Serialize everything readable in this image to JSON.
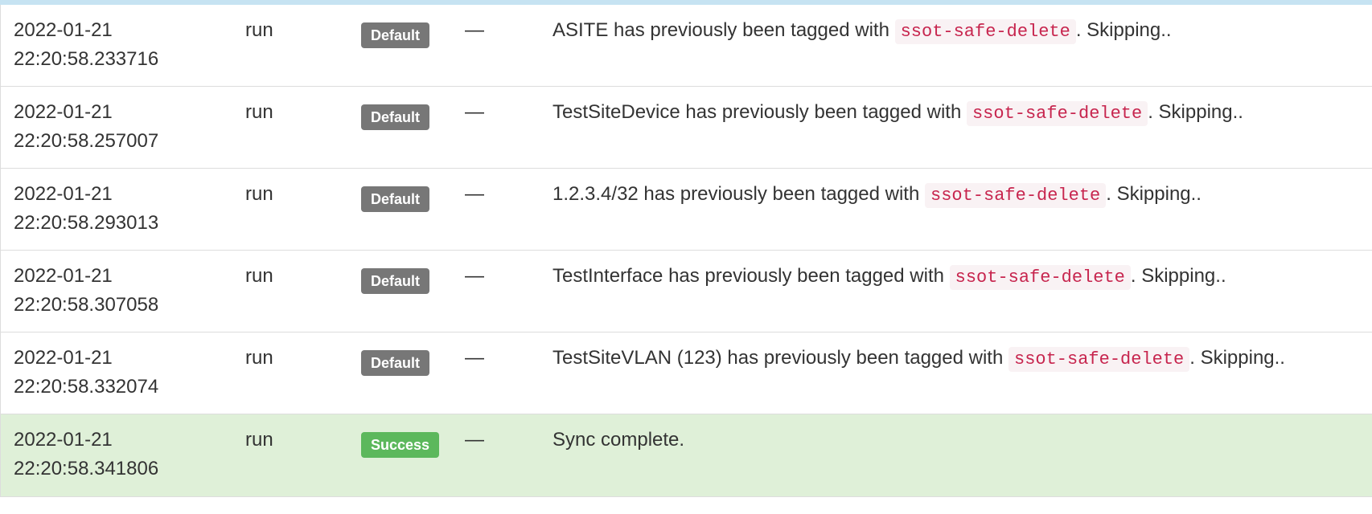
{
  "rows": [
    {
      "date": "2022-01-21",
      "time": "22:20:58.233716",
      "grouping": "run",
      "level": "Default",
      "object": "—",
      "message_pre": "ASITE has previously been tagged with",
      "message_code": "ssot-safe-delete",
      "message_post": ". Skipping.."
    },
    {
      "date": "2022-01-21",
      "time": "22:20:58.257007",
      "grouping": "run",
      "level": "Default",
      "object": "—",
      "message_pre": "TestSiteDevice has previously been tagged with",
      "message_code": "ssot-safe-delete",
      "message_post": ". Skipping.."
    },
    {
      "date": "2022-01-21",
      "time": "22:20:58.293013",
      "grouping": "run",
      "level": "Default",
      "object": "—",
      "message_pre": "1.2.3.4/32 has previously been tagged with",
      "message_code": "ssot-safe-delete",
      "message_post": ". Skipping.."
    },
    {
      "date": "2022-01-21",
      "time": "22:20:58.307058",
      "grouping": "run",
      "level": "Default",
      "object": "—",
      "message_pre": "TestInterface has previously been tagged with",
      "message_code": "ssot-safe-delete",
      "message_post": ". Skipping.."
    },
    {
      "date": "2022-01-21",
      "time": "22:20:58.332074",
      "grouping": "run",
      "level": "Default",
      "object": "—",
      "message_pre": "TestSiteVLAN (123) has previously been tagged with",
      "message_code": "ssot-safe-delete",
      "message_post": ". Skipping.."
    },
    {
      "date": "2022-01-21",
      "time": "22:20:58.341806",
      "grouping": "run",
      "level": "Success",
      "object": "—",
      "message_pre": "Sync complete.",
      "message_code": "",
      "message_post": ""
    }
  ],
  "colors": {
    "default_badge": "#777777",
    "success_badge": "#5cb85c",
    "success_row": "#dff0d8",
    "code_text": "#c7254e",
    "code_bg": "#f9f2f4",
    "top_bar": "#c6e3f2"
  }
}
